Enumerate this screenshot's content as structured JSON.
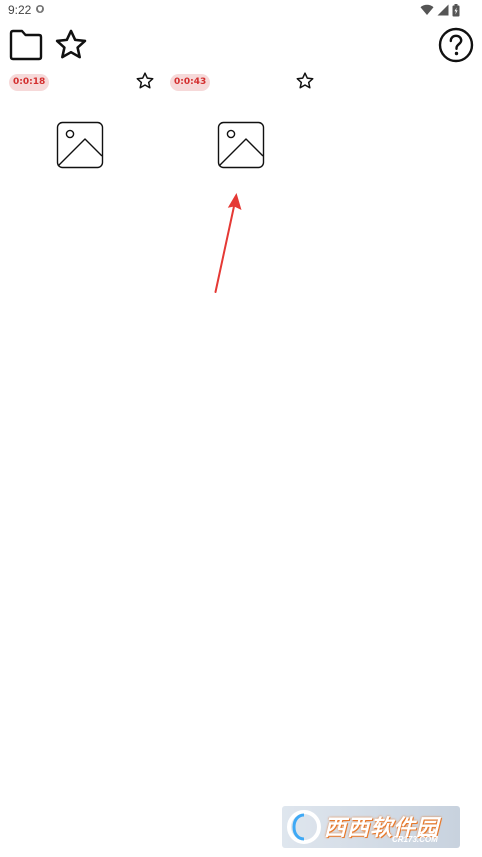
{
  "status_bar": {
    "time": "9:22",
    "icons": [
      "notification-shield-icon",
      "wifi-icon",
      "cell-signal-icon",
      "battery-icon"
    ]
  },
  "toolbar": {
    "left_icons": [
      "folder-icon",
      "star-icon"
    ],
    "right_icons": [
      "help-icon"
    ]
  },
  "media_items": [
    {
      "duration": "0:0:18",
      "icon": "image-placeholder-icon",
      "favorite_icon": "star-outline-icon"
    },
    {
      "duration": "0:0:43",
      "icon": "image-placeholder-icon",
      "favorite_icon": "star-outline-icon"
    }
  ],
  "annotation": {
    "arrow_color": "#e53935"
  },
  "watermark": {
    "logo_text": "西西软件园",
    "sub_text": "CR173.COM"
  },
  "colors": {
    "badge_background": "#f6d9d9",
    "badge_text": "#d32f2f",
    "icon_stroke": "#111111"
  }
}
